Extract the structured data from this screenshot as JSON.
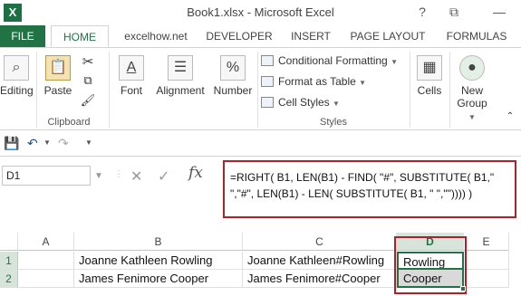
{
  "window": {
    "title": "Book1.xlsx - Microsoft Excel",
    "app_icon": "X",
    "help": "?",
    "restore": "⧉",
    "minimize": "—"
  },
  "tabs": [
    "FILE",
    "HOME",
    "excelhow.net",
    "DEVELOPER",
    "INSERT",
    "PAGE LAYOUT",
    "FORMULAS"
  ],
  "ribbon": {
    "editing": "Editing",
    "paste": "Paste",
    "clipboard": "Clipboard",
    "font": "Font",
    "alignment": "Alignment",
    "number": "Number",
    "number_symbol": "%",
    "conditional_formatting": "Conditional Formatting",
    "format_as_table": "Format as Table",
    "cell_styles": "Cell Styles",
    "styles_group": "Styles",
    "cells": "Cells",
    "new_group_line1": "New",
    "new_group_line2": "Group"
  },
  "formula_bar": {
    "name_box": "D1",
    "cancel": "✕",
    "enter": "✓",
    "fx": "fx",
    "formula_line1": "=RIGHT( B1, LEN(B1) - FIND( \"#\", SUBSTITUTE( B1,\"",
    "formula_line2": "\",\"#\", LEN(B1) - LEN( SUBSTITUTE( B1, \" \",\"\")))) )"
  },
  "grid": {
    "columns": [
      "A",
      "B",
      "C",
      "D",
      "E"
    ],
    "rows": [
      {
        "num": "1",
        "A": "",
        "B": "Joanne Kathleen Rowling",
        "C": "Joanne Kathleen#Rowling",
        "D": "Rowling",
        "E": ""
      },
      {
        "num": "2",
        "A": "",
        "B": "James Fenimore Cooper",
        "C": "James Fenimore#Cooper",
        "D": "Cooper",
        "E": ""
      }
    ]
  },
  "colors": {
    "excel_green": "#217346",
    "highlight_red": "#a8242c"
  }
}
